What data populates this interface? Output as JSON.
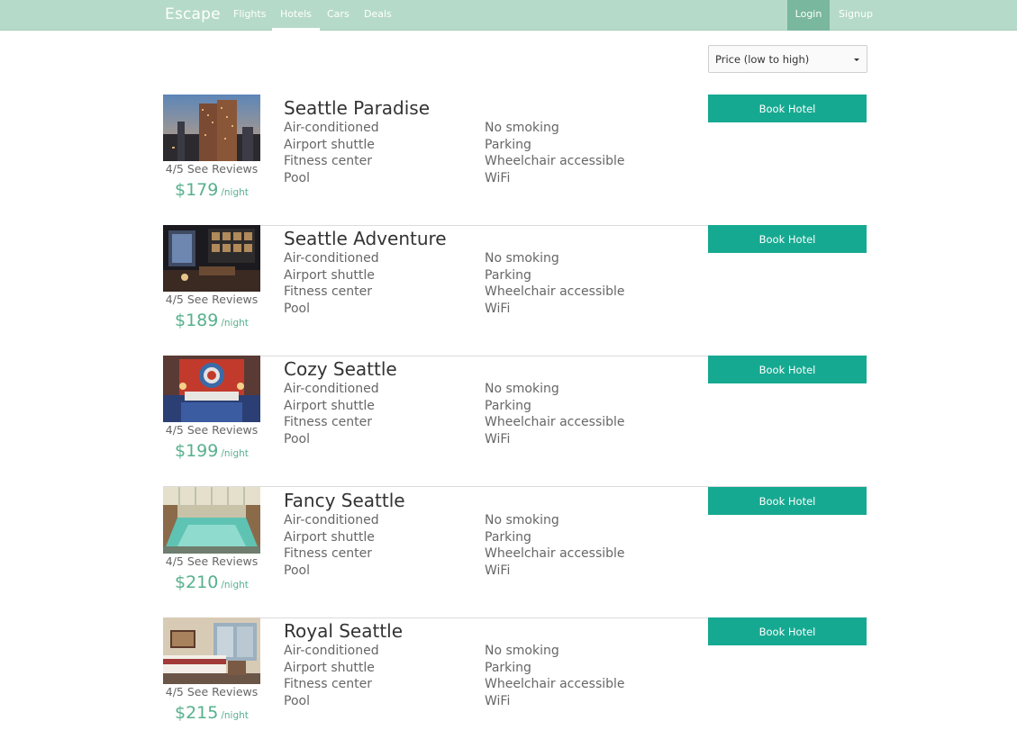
{
  "nav": {
    "brand": "Escape",
    "links": [
      "Flights",
      "Hotels",
      "Cars",
      "Deals"
    ],
    "active": "Hotels",
    "login": "Login",
    "signup": "Signup"
  },
  "sort": {
    "selected": "Price (low to high)"
  },
  "amenities_left": [
    "Air-conditioned",
    "Airport shuttle",
    "Fitness center",
    "Pool"
  ],
  "amenities_right": [
    "No smoking",
    "Parking",
    "Wheelchair accessible",
    "WiFi"
  ],
  "book_label": "Book Hotel",
  "colors": {
    "navbar": "#b6dac9",
    "login_bg": "#79b79e",
    "accent": "#16a991",
    "price": "#57b08e"
  },
  "hotels": [
    {
      "name": "Seattle Paradise",
      "reviews": "4/5 See Reviews",
      "price": "$179",
      "unit": "/night"
    },
    {
      "name": "Seattle Adventure",
      "reviews": "4/5 See Reviews",
      "price": "$189",
      "unit": "/night"
    },
    {
      "name": "Cozy Seattle",
      "reviews": "4/5 See Reviews",
      "price": "$199",
      "unit": "/night"
    },
    {
      "name": "Fancy Seattle",
      "reviews": "4/5 See Reviews",
      "price": "$210",
      "unit": "/night"
    },
    {
      "name": "Royal Seattle",
      "reviews": "4/5 See Reviews",
      "price": "$215",
      "unit": "/night"
    }
  ]
}
